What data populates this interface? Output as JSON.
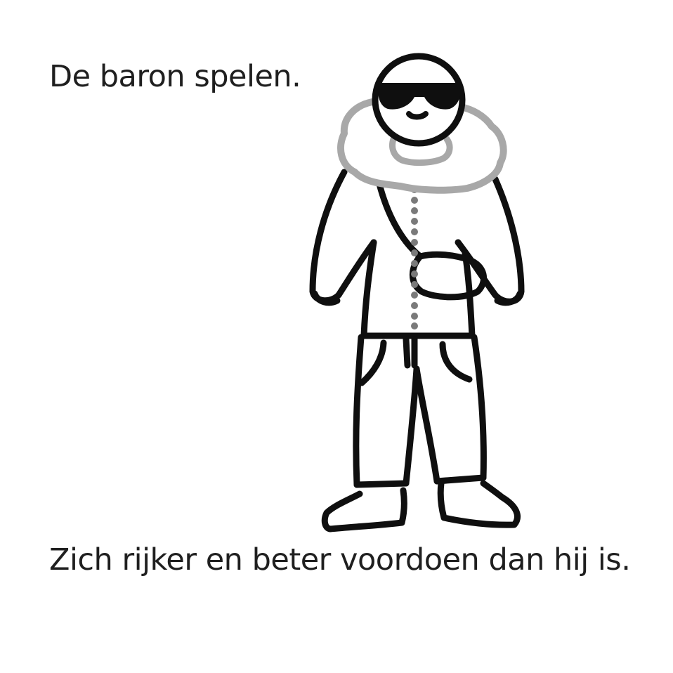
{
  "idiom": {
    "phrase": "De baron spelen.",
    "meaning": "Zich rijker en beter voordoen dan hij is."
  },
  "illustration": {
    "icon": "baron-figure-icon",
    "colors": {
      "outline": "#0f0f0f",
      "fur_collar": "#a8a8a8",
      "zipper": "#7a7a7a",
      "background": "#ffffff"
    }
  }
}
